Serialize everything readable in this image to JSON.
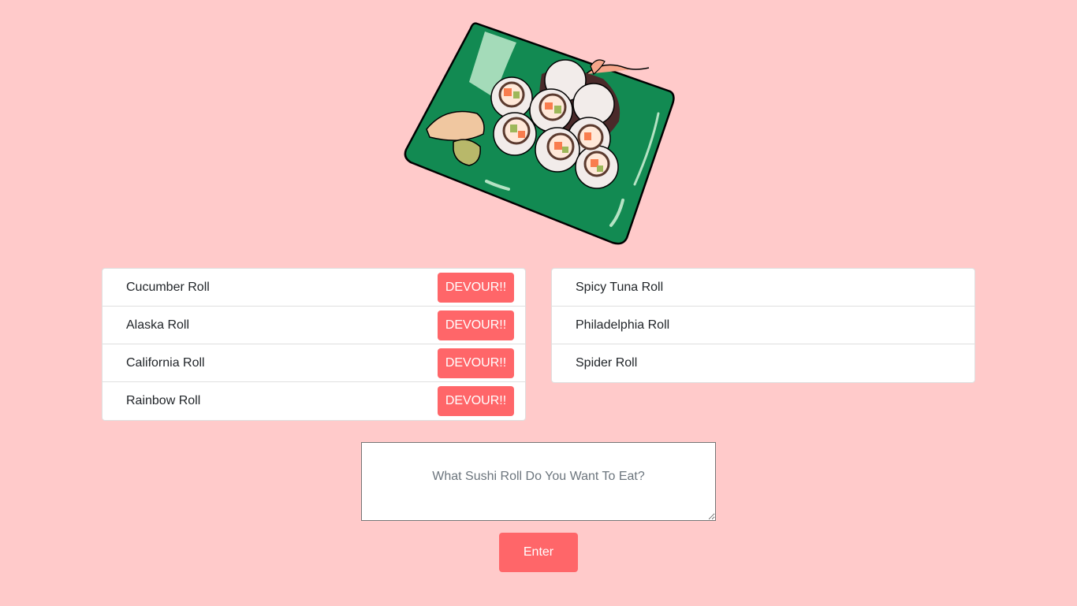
{
  "hero": {
    "image": "sushi-platter-illustration"
  },
  "undevoured": {
    "items": [
      {
        "label": "Cucumber Roll",
        "button": "DEVOUR!!"
      },
      {
        "label": "Alaska Roll",
        "button": "DEVOUR!!"
      },
      {
        "label": "California Roll",
        "button": "DEVOUR!!"
      },
      {
        "label": "Rainbow Roll",
        "button": "DEVOUR!!"
      }
    ]
  },
  "devoured": {
    "items": [
      {
        "label": "Spicy Tuna Roll"
      },
      {
        "label": "Philadelphia Roll"
      },
      {
        "label": "Spider Roll"
      }
    ]
  },
  "form": {
    "placeholder": "What Sushi Roll Do You Want To Eat?",
    "value": "",
    "submit_label": "Enter"
  },
  "colors": {
    "background": "#ffcaca",
    "accent": "#ff6669",
    "plate": "#128a52"
  }
}
